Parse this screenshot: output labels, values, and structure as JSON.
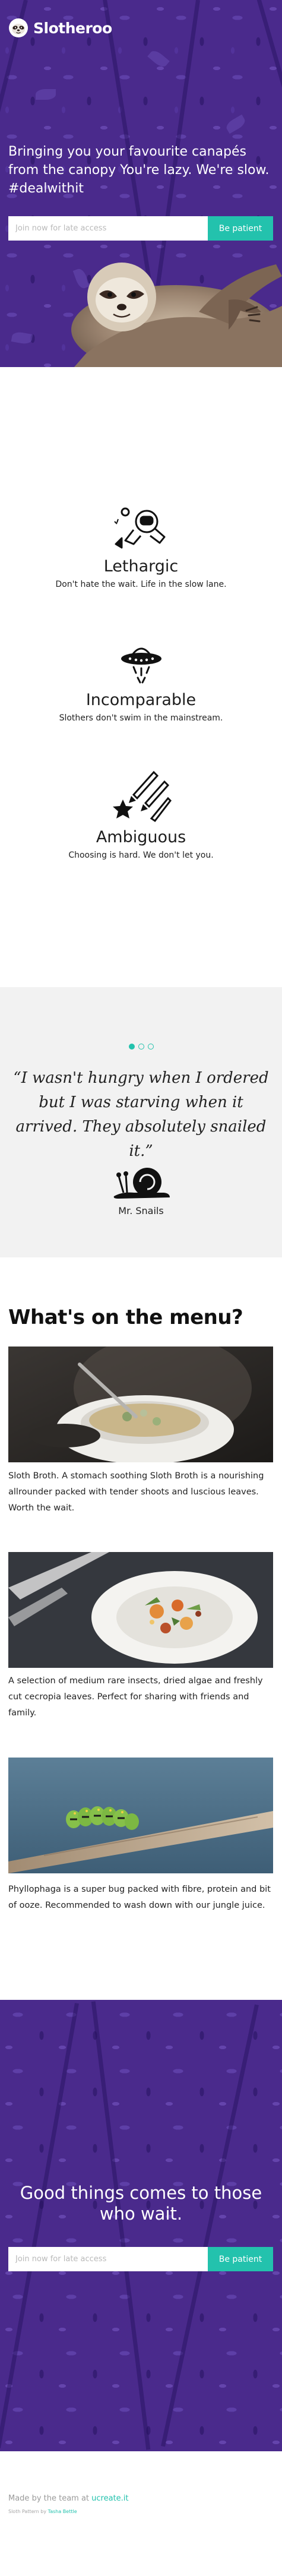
{
  "brand": {
    "name": "Slotheroo",
    "logo_icon": "sloth-face-icon"
  },
  "hero": {
    "headline": "Bringing you your favourite canapés from the canopy You're lazy. We're slow. #dealwithit",
    "input_placeholder": "Join now for late access",
    "button_label": "Be patient",
    "image_icon": "sloth-photo"
  },
  "features": [
    {
      "icon": "astronaut-icon",
      "title": "Lethargic",
      "text": "Don't hate the wait. Life in the slow lane."
    },
    {
      "icon": "ufo-icon",
      "title": "Incomparable",
      "text": "Slothers don't swim in the mainstream."
    },
    {
      "icon": "shooting-stars-icon",
      "title": "Ambiguous",
      "text": "Choosing is hard. We don't let you."
    }
  ],
  "testimonial": {
    "quote": "“I wasn't hungry when I ordered but I was starving when it arrived. They absolutely snailed it.”",
    "author": "Mr. Snails",
    "author_icon": "snail-icon",
    "slides": 3,
    "active_slide": 1
  },
  "menu": {
    "heading": "What's on the menu?",
    "items": [
      {
        "image": "soup-bowl-photo",
        "description": "Sloth Broth. A stomach soothing Sloth Broth is a nourishing allrounder packed with tender shoots and luscious leaves. Worth the wait."
      },
      {
        "image": "salad-plate-photo",
        "description": "A selection of medium rare insects, dried algae and freshly cut cecropia leaves. Perfect for sharing with friends and family."
      },
      {
        "image": "caterpillar-photo",
        "description": "Phyllophaga is a super bug packed with fibre, protein and bit of ooze. Recommended to wash down with our jungle juice."
      }
    ]
  },
  "cta": {
    "title": "Good things comes to those who wait.",
    "input_placeholder": "Join now for late access",
    "button_label": "Be patient"
  },
  "footer": {
    "made_by_prefix": "Made by the team at",
    "made_by_link": "ucreate.it",
    "pattern_prefix": "Sloth Pattern by",
    "pattern_link": "Tasha Bettle"
  },
  "colors": {
    "purple": "#4a2a8c",
    "accent": "#23c2ad",
    "light_bg": "#f2f2f2"
  }
}
